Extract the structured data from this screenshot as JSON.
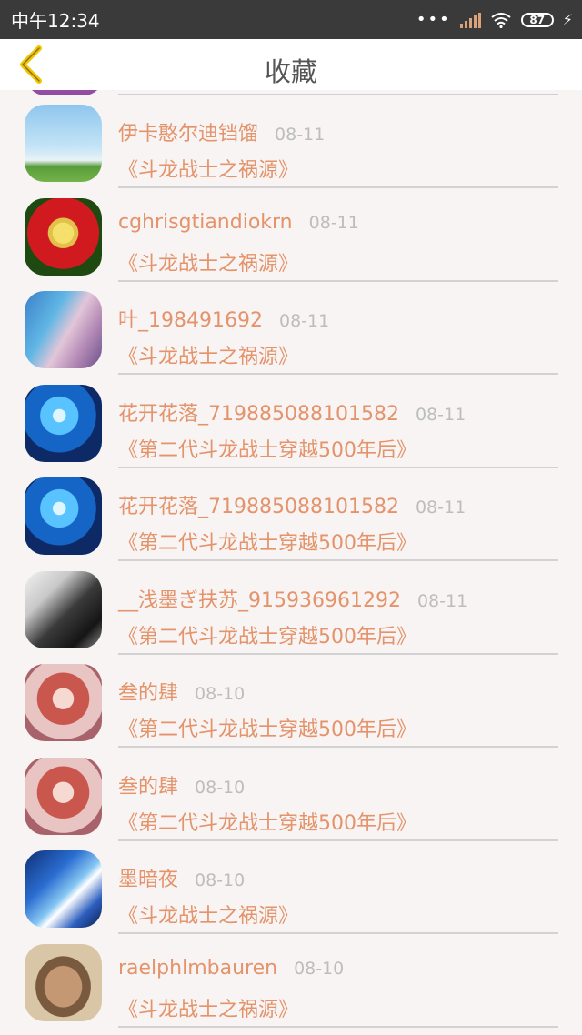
{
  "status_bar": {
    "time": "中午12:34",
    "battery": "87"
  },
  "header": {
    "title": "收藏"
  },
  "items": [
    {
      "name": "伊卡憨尔迪铛馏",
      "date": "08-11",
      "book": "《斗龙战士之祸源》",
      "avatar_icon": "avatar-sky-landscape"
    },
    {
      "name": "cghrisgtiandiokrn",
      "date": "08-11",
      "book": "《斗龙战士之祸源》",
      "avatar_icon": "avatar-red-rose"
    },
    {
      "name": "叶_198491692",
      "date": "08-11",
      "book": "《斗龙战士之祸源》",
      "avatar_icon": "avatar-anime-couple"
    },
    {
      "name": "花开花落_719885088101582",
      "date": "08-11",
      "book": "《第二代斗龙战士穿越500年后》",
      "avatar_icon": "avatar-anime-wings"
    },
    {
      "name": "花开花落_719885088101582",
      "date": "08-11",
      "book": "《第二代斗龙战士穿越500年后》",
      "avatar_icon": "avatar-anime-wings"
    },
    {
      "name": "__浅墨ぎ扶苏_915936961292",
      "date": "08-11",
      "book": "《第二代斗龙战士穿越500年后》",
      "avatar_icon": "avatar-anime-dark"
    },
    {
      "name": "叁的肆",
      "date": "08-10",
      "book": "《第二代斗龙战士穿越500年后》",
      "avatar_icon": "avatar-anime-red-hair"
    },
    {
      "name": "叁的肆",
      "date": "08-10",
      "book": "《第二代斗龙战士穿越500年后》",
      "avatar_icon": "avatar-anime-red-hair"
    },
    {
      "name": "墨暗夜",
      "date": "08-10",
      "book": "《斗龙战士之祸源》",
      "avatar_icon": "avatar-anime-blue"
    },
    {
      "name": "raelphlmbauren",
      "date": "08-10",
      "book": "《斗龙战士之祸源》",
      "avatar_icon": "avatar-photo-face"
    }
  ],
  "colors": {
    "accent": "#e4936b",
    "back_icon": "#f2c500",
    "status_bar": "#3a3a3a"
  }
}
